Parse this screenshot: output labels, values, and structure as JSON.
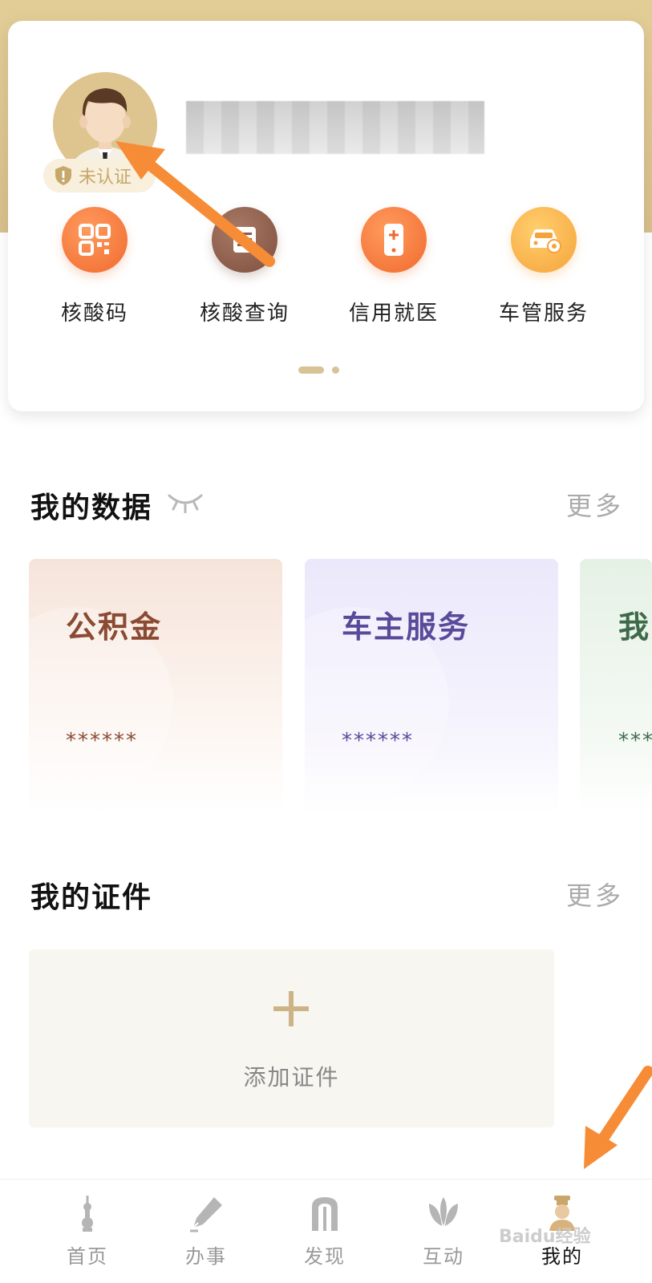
{
  "profile": {
    "badge_text": "未认证"
  },
  "services": [
    {
      "label": "核酸码",
      "icon": "qr-code-icon",
      "color": "#f47a3b"
    },
    {
      "label": "核酸查询",
      "icon": "document-icon",
      "color": "#8c5c4a"
    },
    {
      "label": "信用就医",
      "icon": "phone-medical-icon",
      "color": "#f47a3b"
    },
    {
      "label": "车管服务",
      "icon": "car-service-icon",
      "color": "#f8b04a"
    }
  ],
  "my_data": {
    "title": "我的数据",
    "more": "更多",
    "cards": [
      {
        "title": "公积金",
        "value": "******",
        "color": "#8b4a32"
      },
      {
        "title": "车主服务",
        "value": "******",
        "color": "#5a4a9a"
      },
      {
        "title": "我",
        "value": "***",
        "color": "#3d6b4a"
      }
    ]
  },
  "my_certificates": {
    "title": "我的证件",
    "more": "更多",
    "add_label": "添加证件"
  },
  "tabbar": {
    "items": [
      {
        "label": "首页",
        "icon": "tower-icon"
      },
      {
        "label": "办事",
        "icon": "pen-icon"
      },
      {
        "label": "发现",
        "icon": "arch-icon"
      },
      {
        "label": "互动",
        "icon": "magnolia-icon"
      },
      {
        "label": "我的",
        "icon": "person-icon",
        "active": true
      }
    ]
  },
  "watermark": "Baidu经验",
  "colors": {
    "gold": "#d8c397",
    "accent_orange": "#f47a3b",
    "annotation_arrow": "#f68c36"
  }
}
